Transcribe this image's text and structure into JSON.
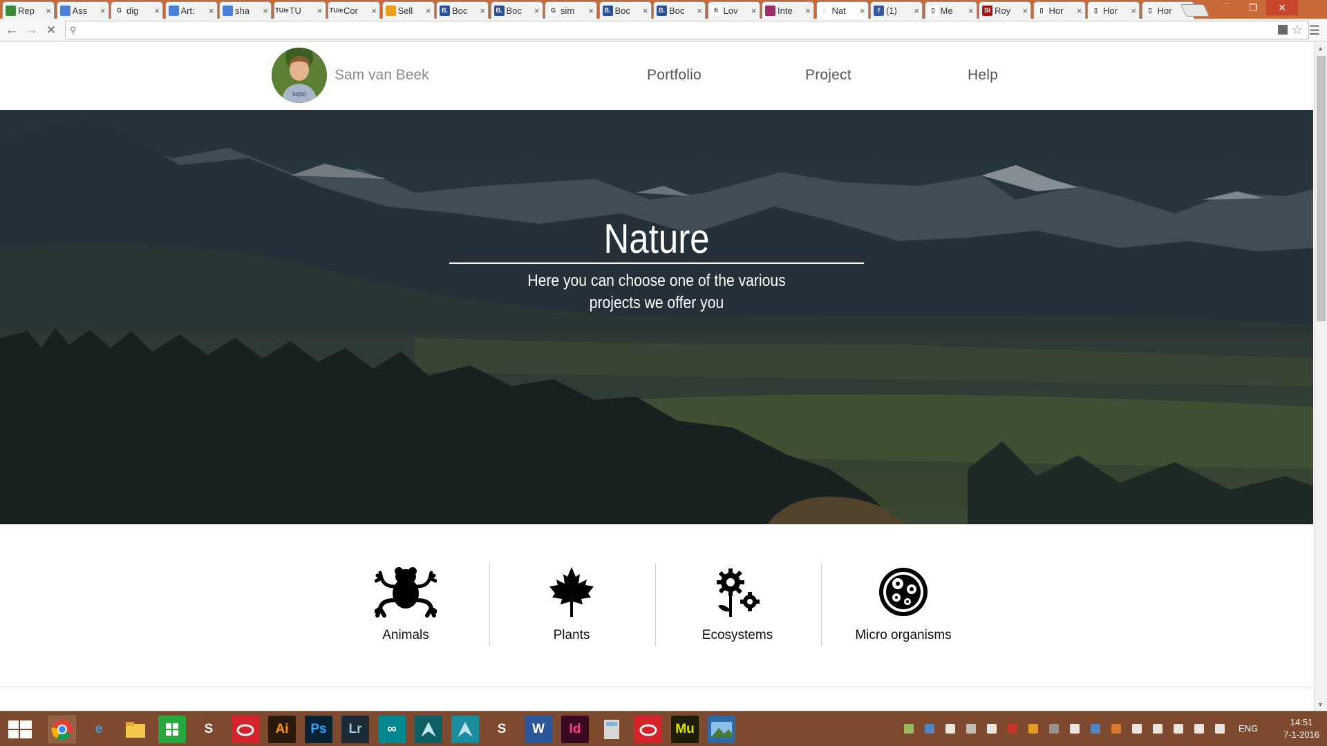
{
  "browser": {
    "tabs": [
      {
        "label": "Rep",
        "color": "#3b8c3a"
      },
      {
        "label": "Ass",
        "color": "#4a7fd6"
      },
      {
        "label": "dig",
        "color": "#ffffff",
        "glyph": "G"
      },
      {
        "label": "Art:",
        "color": "#4a7fd6"
      },
      {
        "label": "sha",
        "color": "#4a7fd6"
      },
      {
        "label": "TU",
        "color": "#ffffff",
        "glyph": "TU/e"
      },
      {
        "label": "Cor",
        "color": "#ffffff",
        "glyph": "TU/e"
      },
      {
        "label": "Sell",
        "color": "#e8a11b"
      },
      {
        "label": "Boc",
        "color": "#2d4f93",
        "glyph": "B."
      },
      {
        "label": "Boc",
        "color": "#2d4f93",
        "glyph": "B."
      },
      {
        "label": "sim",
        "color": "#ffffff",
        "glyph": "G"
      },
      {
        "label": "Boc",
        "color": "#2d4f93",
        "glyph": "B."
      },
      {
        "label": "Boc",
        "color": "#2d4f93",
        "glyph": "B."
      },
      {
        "label": "Lov",
        "color": "#ffffff",
        "glyph": "fi"
      },
      {
        "label": "Inte",
        "color": "#9b2f6a"
      },
      {
        "label": "Nat",
        "color": "#ffffff",
        "glyph": "◌",
        "active": true
      },
      {
        "label": "(1)",
        "color": "#3b5998",
        "glyph": "f"
      },
      {
        "label": "Me",
        "color": "#ffffff",
        "glyph": "▯"
      },
      {
        "label": "Roy",
        "color": "#9b1b1b",
        "glyph": "St"
      },
      {
        "label": "Hor",
        "color": "#ffffff",
        "glyph": "▯"
      },
      {
        "label": "Hor",
        "color": "#ffffff",
        "glyph": "▯"
      },
      {
        "label": "Hor",
        "color": "#ffffff",
        "glyph": "▯"
      }
    ],
    "address_value": "",
    "window_controls": [
      "‾",
      "❐",
      "✕"
    ]
  },
  "site": {
    "name": "Sam van Beek",
    "nav": [
      "Portfolio",
      "Project",
      "Help"
    ]
  },
  "hero": {
    "title": "Nature",
    "subtitle_line1": "Here you can choose one of the various",
    "subtitle_line2": "projects we offer you"
  },
  "projects": [
    {
      "label": "Animals",
      "icon": "frog-icon"
    },
    {
      "label": "Plants",
      "icon": "maple-leaf-icon"
    },
    {
      "label": "Ecosystems",
      "icon": "flower-gears-icon"
    },
    {
      "label": "Micro organisms",
      "icon": "microorganism-icon"
    }
  ],
  "taskbar": {
    "apps": [
      {
        "name": "chrome",
        "glyph": "",
        "bg": "#7d4a2f"
      },
      {
        "name": "internet-explorer",
        "glyph": "e",
        "bg": "#7d4a2f",
        "fg": "#3aa0e6"
      },
      {
        "name": "file-explorer",
        "glyph": "",
        "bg": "#7d4a2f"
      },
      {
        "name": "store",
        "glyph": "",
        "bg": "#2aa63e"
      },
      {
        "name": "skype",
        "glyph": "S",
        "bg": "#7d4a2f",
        "fg": "#ffffff"
      },
      {
        "name": "creative-cloud",
        "glyph": "",
        "bg": "#d3232b"
      },
      {
        "name": "illustrator",
        "glyph": "Ai",
        "bg": "#2b1a0c",
        "fg": "#ff9a00"
      },
      {
        "name": "photoshop",
        "glyph": "Ps",
        "bg": "#0b2233",
        "fg": "#31a8ff"
      },
      {
        "name": "lightroom",
        "glyph": "Lr",
        "bg": "#1d2a33",
        "fg": "#a4c8e0"
      },
      {
        "name": "arduino",
        "glyph": "∞",
        "bg": "#00878f",
        "fg": "#ffffff"
      },
      {
        "name": "3ds-max",
        "glyph": "",
        "bg": "#0f5e63"
      },
      {
        "name": "maya",
        "glyph": "",
        "bg": "#1a8ea0"
      },
      {
        "name": "skype-2",
        "glyph": "S",
        "bg": "#7d4a2f",
        "fg": "#ffffff"
      },
      {
        "name": "word",
        "glyph": "W",
        "bg": "#2b579a",
        "fg": "#ffffff"
      },
      {
        "name": "indesign",
        "glyph": "Id",
        "bg": "#3a0a22",
        "fg": "#ff3d8b"
      },
      {
        "name": "calculator",
        "glyph": "",
        "bg": "#7d4a2f"
      },
      {
        "name": "creative-cloud-2",
        "glyph": "",
        "bg": "#d3232b"
      },
      {
        "name": "muse",
        "glyph": "Mu",
        "bg": "#1d1d05",
        "fg": "#e2e200"
      },
      {
        "name": "photos",
        "glyph": "",
        "bg": "#2f6aa3"
      }
    ],
    "language": "ENG",
    "time": "14:51",
    "date": "7-1-2016"
  }
}
